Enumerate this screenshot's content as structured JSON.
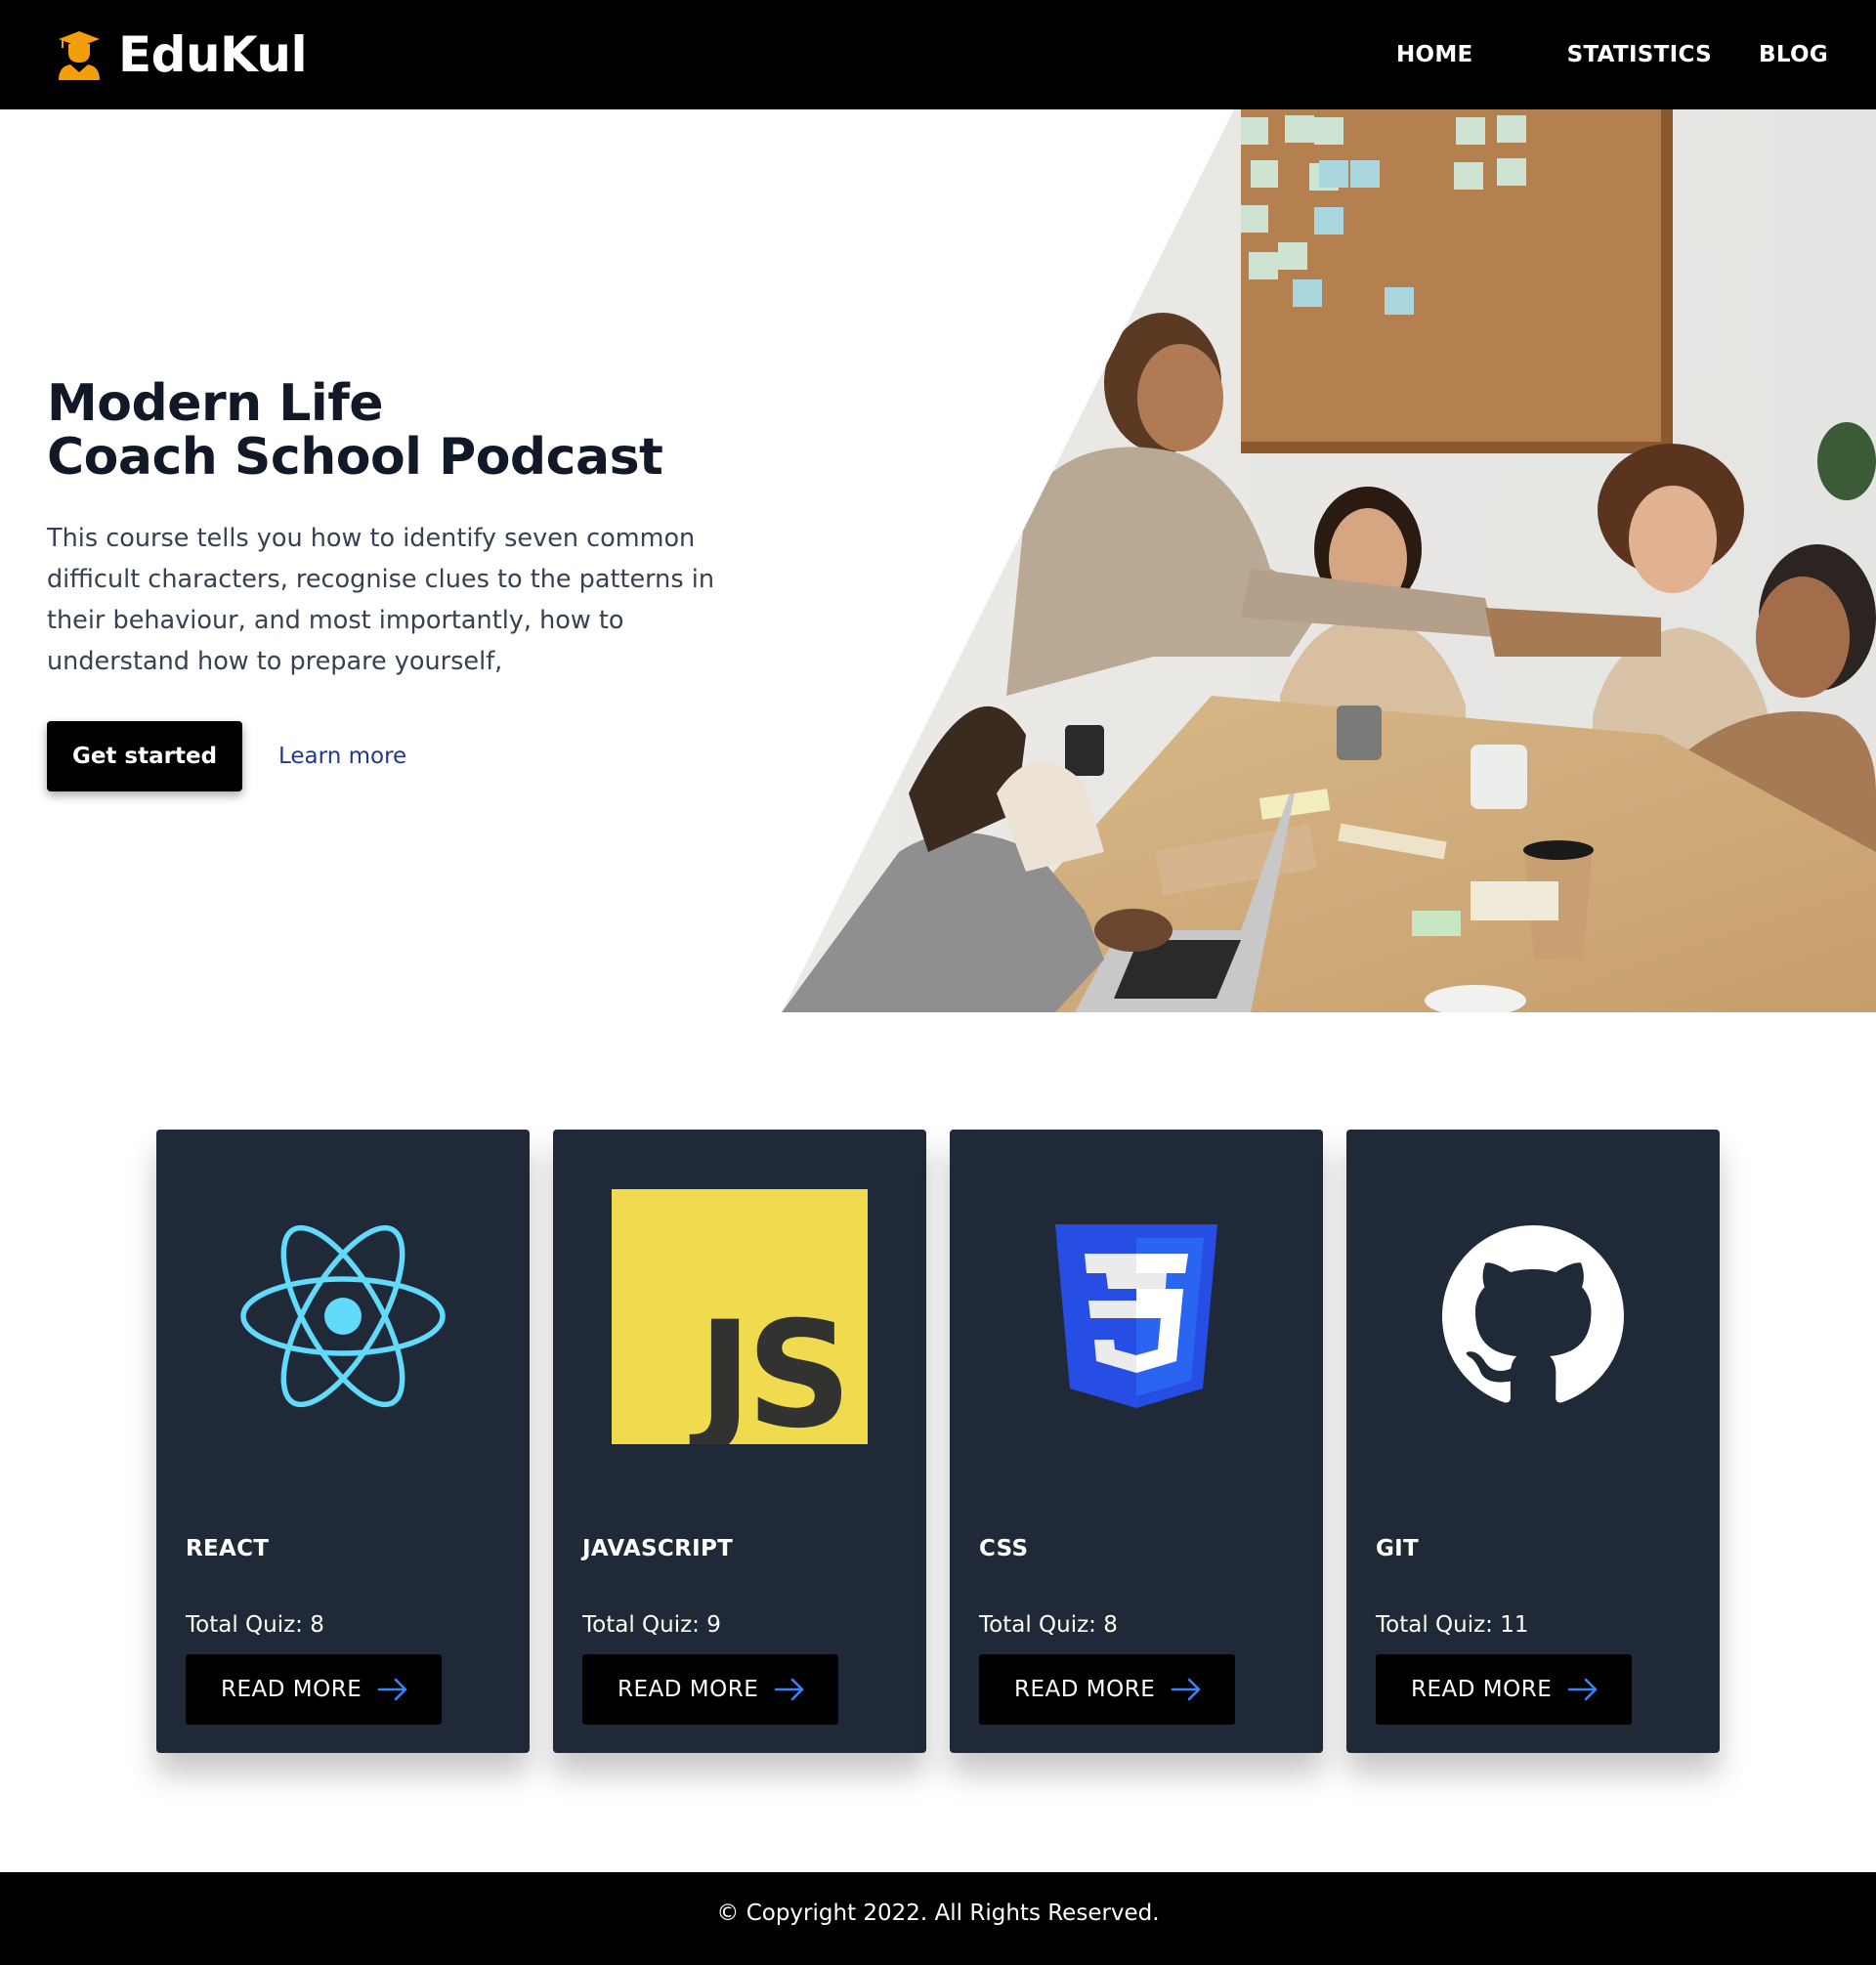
{
  "brand": {
    "name": "EduKul",
    "logo_icon": "graduate-icon",
    "logo_color": "#f59e0b"
  },
  "nav": {
    "items": [
      {
        "label": "HOME"
      },
      {
        "label": "STATISTICS"
      },
      {
        "label": "BLOG"
      }
    ]
  },
  "hero": {
    "title_line1": "Modern Life",
    "title_line2": "Coach School Podcast",
    "description": "This course tells you how to identify seven common difficult characters, recognise clues to the patterns in their behaviour, and most importantly, how to understand how to prepare yourself,",
    "primary_button": "Get started",
    "secondary_link": "Learn more",
    "image_icon": "team-meeting-photo"
  },
  "cards": [
    {
      "title": "REACT",
      "quiz_text": "Total Quiz: 8",
      "button": "READ MORE",
      "icon": "react-icon",
      "icon_color": "#61dafb"
    },
    {
      "title": "JAVASCRIPT",
      "quiz_text": "Total Quiz: 9",
      "button": "READ MORE",
      "icon": "javascript-icon",
      "icon_color": "#f0db4f"
    },
    {
      "title": "CSS",
      "quiz_text": "Total Quiz: 8",
      "button": "READ MORE",
      "icon": "css3-icon",
      "icon_color": "#264de4"
    },
    {
      "title": "GIT",
      "quiz_text": "Total Quiz: 11",
      "button": "READ MORE",
      "icon": "github-icon",
      "icon_color": "#ffffff"
    }
  ],
  "colors": {
    "header_bg": "#000000",
    "card_bg": "#1f2937",
    "link": "#1e3a8a",
    "arrow": "#3b82f6"
  },
  "footer": {
    "copyright": "© Copyright 2022. All Rights Reserved."
  }
}
